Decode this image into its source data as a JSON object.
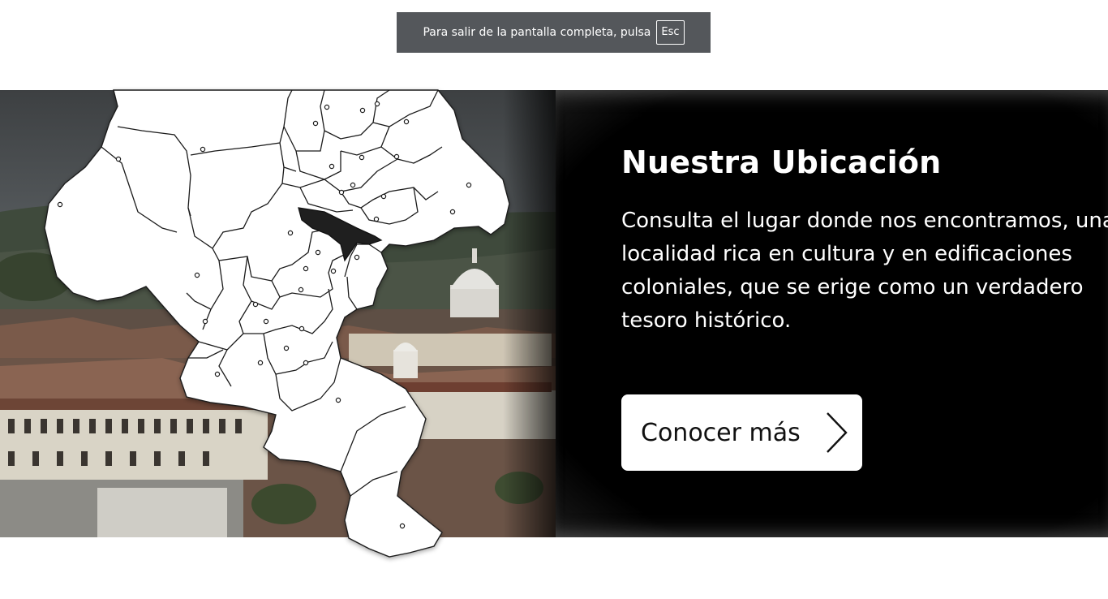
{
  "fullscreen_notice": {
    "message": "Para salir de la pantalla completa, pulsa",
    "key": "Esc"
  },
  "location": {
    "heading": "Nuestra Ubicación",
    "description": "Consulta el lugar donde nos encontramos, una localidad rica en cultura y en edificaciones coloniales, que se erige como un verdadero tesoro histórico.",
    "button_label": "Conocer más",
    "button_icon": "chevron-right-icon"
  },
  "map": {
    "icon": "department-map-icon",
    "highlight_color": "#1f1f1f",
    "fill_color": "#ffffff",
    "line_color": "#111111"
  },
  "colors": {
    "panel": "#000000",
    "notice_bg": "#54575b",
    "button_bg": "#ffffff"
  }
}
